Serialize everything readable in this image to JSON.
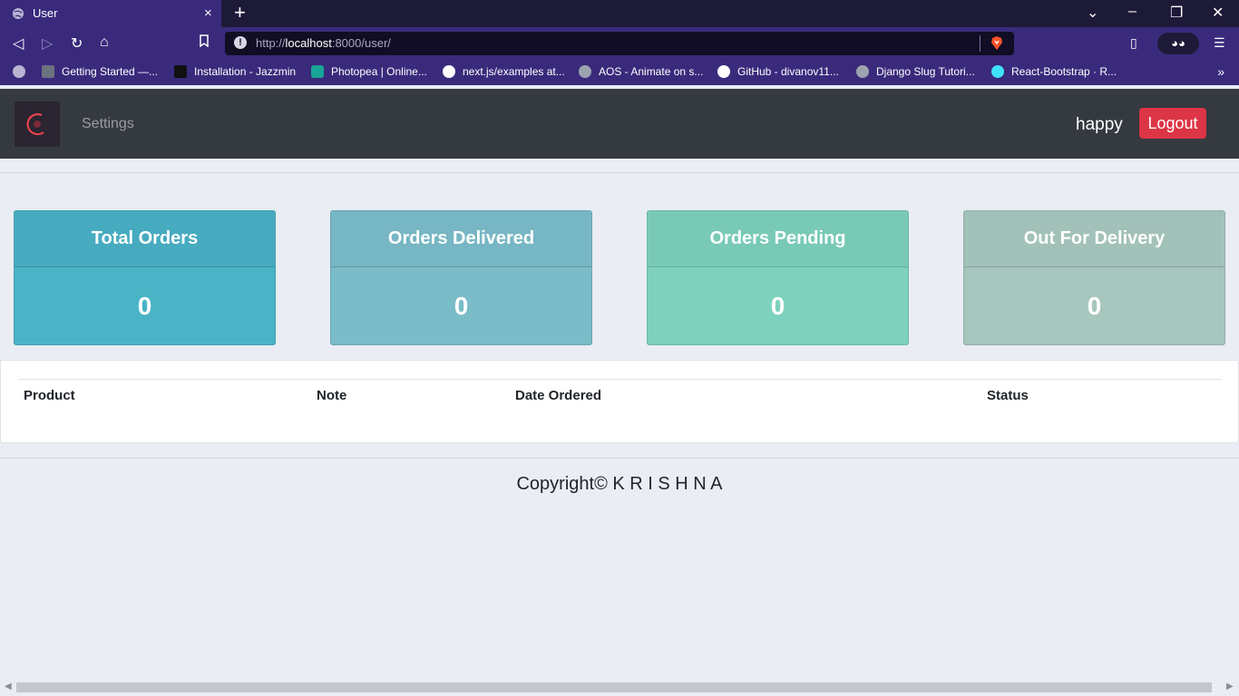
{
  "browser": {
    "tab_title": "User",
    "tab_close": "×",
    "new_tab": "+",
    "url_scheme": "http://",
    "url_host": "localhost",
    "url_rest": ":8000/user/",
    "bookmarks": [
      {
        "label": "Getting Started —...",
        "color": "#6b7280"
      },
      {
        "label": "Installation - Jazzmin",
        "color": "#111111"
      },
      {
        "label": "Photopea | Online...",
        "color": "#18a497"
      },
      {
        "label": "next.js/examples at...",
        "color": "#ffffff"
      },
      {
        "label": "AOS - Animate on s...",
        "color": "#9ca3af"
      },
      {
        "label": "GitHub - divanov11...",
        "color": "#ffffff"
      },
      {
        "label": "Django Slug Tutori...",
        "color": "#9ca3af"
      },
      {
        "label": "React-Bootstrap · R...",
        "color": "#41e0fd"
      }
    ],
    "bookmarks_more": "»"
  },
  "site": {
    "settings_label": "Settings",
    "username": "happy",
    "logout_label": "Logout",
    "accent_danger": "#dc3545"
  },
  "cards": [
    {
      "title": "Total Orders",
      "value": "0"
    },
    {
      "title": "Orders Delivered",
      "value": "0"
    },
    {
      "title": "Orders Pending",
      "value": "0"
    },
    {
      "title": "Out For Delivery",
      "value": "0"
    }
  ],
  "table": {
    "headers": [
      "Product",
      "Note",
      "Date Ordered",
      "Status"
    ]
  },
  "footer": {
    "copyright": "Copyright© K R I S H N A"
  }
}
